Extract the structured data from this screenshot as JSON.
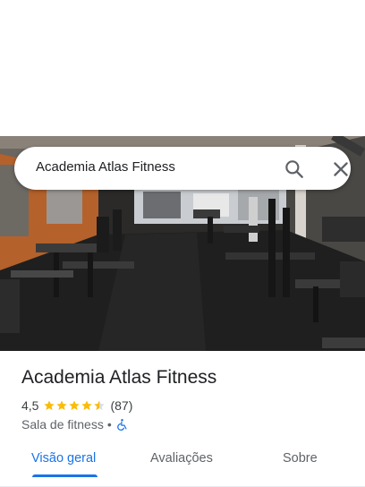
{
  "search": {
    "query": "Academia Atlas Fitness",
    "search_icon": "search-icon",
    "close_icon": "close-icon"
  },
  "hero": {
    "image": "gym-interior-photo"
  },
  "place": {
    "name": "Academia Atlas Fitness",
    "rating": "4,5",
    "stars": 4.5,
    "review_count": "(87)",
    "category": "Sala de fitness",
    "separator": "•",
    "accessibility_icon": "wheelchair-accessible-icon"
  },
  "tabs": [
    {
      "label": "Visão geral",
      "active": true
    },
    {
      "label": "Avaliações",
      "active": false
    },
    {
      "label": "Sobre",
      "active": false
    }
  ],
  "colors": {
    "accent": "#1a73e8",
    "star": "#fbbc04",
    "text": "#202124",
    "secondary_text": "#5f6368"
  }
}
